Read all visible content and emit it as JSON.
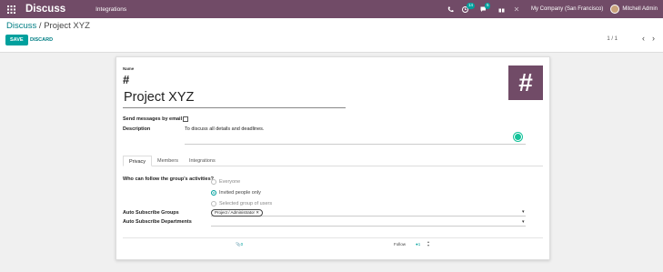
{
  "navbar": {
    "app_title": "Discuss",
    "menu_item": "Integrations",
    "activity_badge": "14",
    "messages_badge": "5",
    "company": "My Company (San Francisco)",
    "user_name": "Mitchell Admin",
    "accent": "#714b67"
  },
  "breadcrumb": {
    "parent": "Discuss",
    "separator": " / ",
    "current": "Project XYZ"
  },
  "toolbar": {
    "save_label": "SAVE",
    "discard_label": "DISCARD"
  },
  "pager": {
    "value": "1 / 1",
    "prev": "‹",
    "next": "›"
  },
  "form": {
    "name_label": "Name",
    "hash": "#",
    "name_value": "Project XYZ",
    "avatar_symbol": "#",
    "send_email_label": "Send messages by email",
    "description_label": "Description",
    "description_value": "To discuss all details and deadlines.",
    "tabs": [
      "Privacy",
      "Members",
      "Integrations"
    ],
    "who_follow_label": "Who can follow the group's activities?",
    "radio_options": [
      {
        "label": "Everyone",
        "checked": false
      },
      {
        "label": "Invited people only",
        "checked": true
      },
      {
        "label": "Selected group of users",
        "checked": false
      }
    ],
    "auto_groups_label": "Auto Subscribe Groups",
    "auto_groups_tag": "Project / Administrator",
    "auto_departments_label": "Auto Subscribe Departments",
    "caret": "▾"
  },
  "chatter": {
    "attachments": "0",
    "follow_label": "Follow",
    "followers": "1"
  }
}
